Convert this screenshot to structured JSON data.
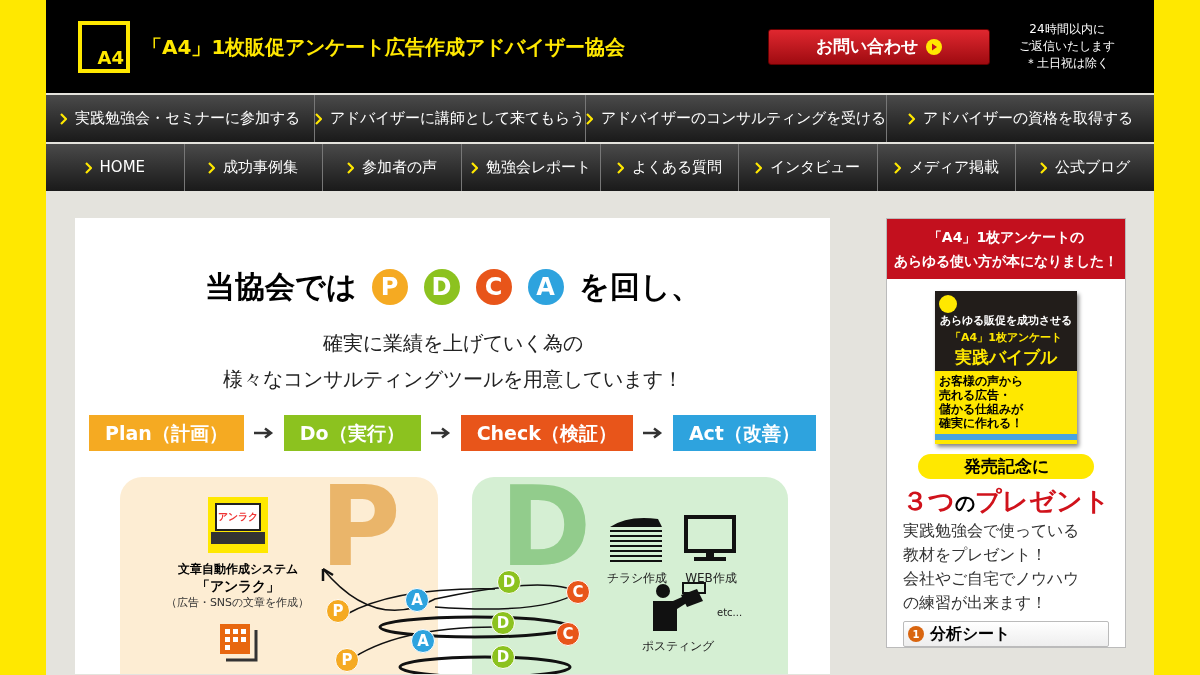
{
  "header": {
    "logo_mark": "A4",
    "title": "「A4」1枚販促アンケート広告作成アドバイザー協会",
    "contact_button": "お問い合わせ",
    "reply_note": [
      "24時間以内に",
      "ご返信いたします",
      "＊土日祝は除く"
    ]
  },
  "nav_rows": [
    {
      "items": [
        {
          "label": "実践勉強会・セミナーに参加する"
        },
        {
          "label": "アドバイザーに講師として来てもらう"
        },
        {
          "label": "アドバイザーのコンサルティングを受ける"
        },
        {
          "label": "アドバイザーの資格を取得する"
        }
      ]
    },
    {
      "items": [
        {
          "label": "HOME"
        },
        {
          "label": "成功事例集"
        },
        {
          "label": "参加者の声"
        },
        {
          "label": "勉強会レポート"
        },
        {
          "label": "よくある質問"
        },
        {
          "label": "インタビュー"
        },
        {
          "label": "メディア掲載"
        },
        {
          "label": "公式ブログ"
        }
      ]
    }
  ],
  "main": {
    "headline_before": "当協会では",
    "pdca": [
      {
        "letter": "P",
        "color": "#f5aa22"
      },
      {
        "letter": "D",
        "color": "#8cc21f"
      },
      {
        "letter": "C",
        "color": "#e8551a"
      },
      {
        "letter": "A",
        "color": "#2ea3de"
      }
    ],
    "headline_after": "を回し、",
    "subtitle": [
      "確実に業績を上げていく為の",
      "様々なコンサルティングツールを用意しています！"
    ],
    "steps": [
      {
        "label": "Plan（計画）",
        "color": "#f5aa22"
      },
      {
        "label": "Do（実行）",
        "color": "#8cc21f"
      },
      {
        "label": "Check（検証）",
        "color": "#e8551a"
      },
      {
        "label": "Act（改善）",
        "color": "#2ea3de"
      }
    ],
    "plan_panel": {
      "letter": "P",
      "screen_text": "アンラク",
      "tool_title": "文章自動作成システム",
      "tool_name": "「アンラク」",
      "tool_note": "（広告・SNSの文章を作成）"
    },
    "do_panel": {
      "letter": "D",
      "items": [
        {
          "kind": "flyer",
          "label": "チラシ作成"
        },
        {
          "kind": "web",
          "label": "WEB作成"
        },
        {
          "kind": "posting",
          "label": "ポスティング"
        }
      ],
      "etc": "etc..."
    },
    "cycle_marks": [
      {
        "letter": "D",
        "color": "#8cc21f"
      },
      {
        "letter": "C",
        "color": "#e8551a"
      },
      {
        "letter": "A",
        "color": "#2ea3de"
      },
      {
        "letter": "P",
        "color": "#f5aa22"
      },
      {
        "letter": "D",
        "color": "#8cc21f"
      },
      {
        "letter": "C",
        "color": "#e8551a"
      },
      {
        "letter": "A",
        "color": "#2ea3de"
      },
      {
        "letter": "P",
        "color": "#f5aa22"
      },
      {
        "letter": "D",
        "color": "#8cc21f"
      }
    ]
  },
  "sidebar": {
    "banner": [
      "「A4」1枚アンケートの",
      "あらゆる使い方が本になりました！"
    ],
    "book": {
      "lead": "あらゆる販促を成功させる",
      "title": "「A4」1枚アンケート",
      "subtitle": "実践バイブル",
      "pitch": [
        "お客様の声から",
        "売れる広告・",
        "儲かる仕組みが",
        "確実に作れる！"
      ]
    },
    "pill": "発売記念に",
    "present": [
      {
        "text": "３つ",
        "kind": "accent"
      },
      {
        "text": "の",
        "kind": "plain"
      },
      {
        "text": "プレゼント",
        "kind": "accent"
      }
    ],
    "description": [
      "実践勉強会で使っている",
      "教材をプレゼント！",
      "会社やご自宅でノウハウ",
      "の練習が出来ます！"
    ],
    "gifts": [
      {
        "number": "1",
        "label": "分析シート"
      }
    ]
  }
}
